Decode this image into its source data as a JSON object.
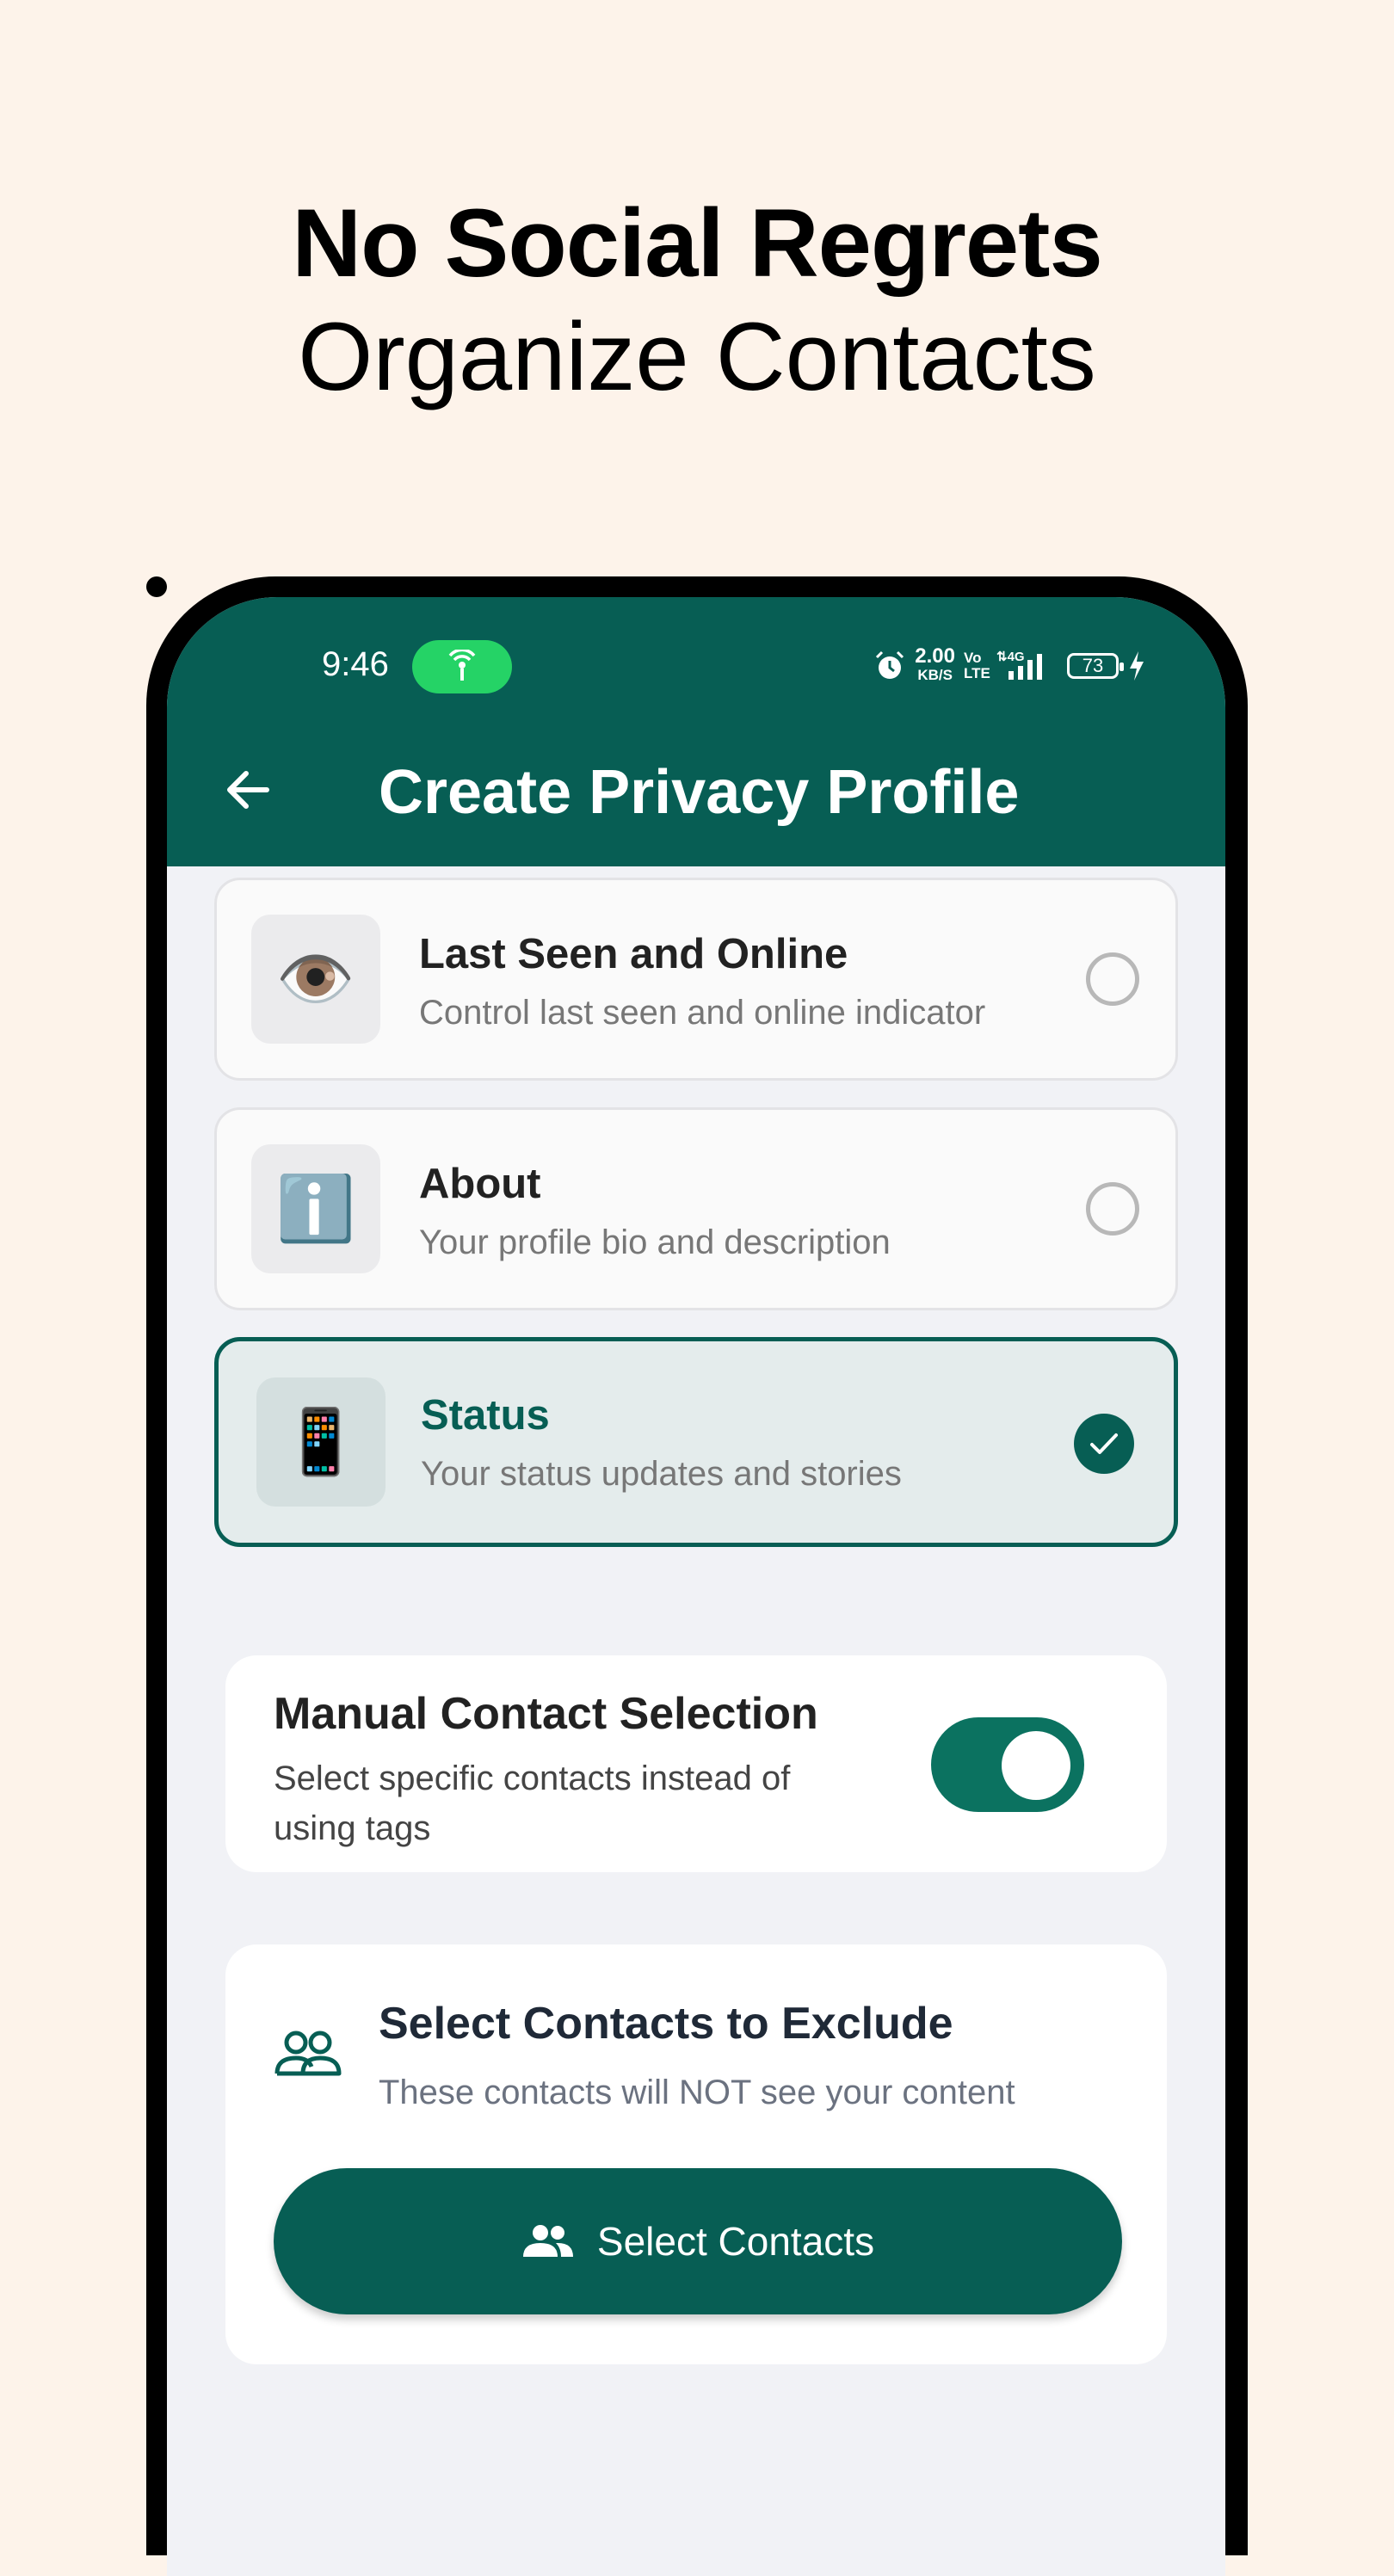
{
  "marketing": {
    "headline": "No Social Regrets",
    "subheadline": "Organize Contacts"
  },
  "status_bar": {
    "time": "9:46",
    "net_speed": "2.00",
    "net_speed_unit": "KB/S",
    "volte": "Vo LTE",
    "network": "4G",
    "battery": "73"
  },
  "app_bar": {
    "title": "Create Privacy Profile"
  },
  "options": [
    {
      "icon": "eye-icon",
      "emoji": "👁️",
      "title": "Last Seen and Online",
      "description": "Control last seen and online indicator",
      "selected": false
    },
    {
      "icon": "info-icon",
      "emoji": "ℹ️",
      "title": "About",
      "description": "Your profile bio and description",
      "selected": false
    },
    {
      "icon": "mobile-phone-icon",
      "emoji": "📱",
      "title": "Status",
      "description": "Your status updates and stories",
      "selected": true
    }
  ],
  "manual_selection": {
    "title": "Manual Contact Selection",
    "description": "Select specific contacts instead of using tags",
    "enabled": true
  },
  "exclude": {
    "icon": "people-icon",
    "title": "Select Contacts to Exclude",
    "description": "These contacts will NOT see your content",
    "button_label": "Select Contacts"
  },
  "colors": {
    "brand": "#075e54",
    "toggle_on": "#0b7260",
    "background": "#fdf3ea",
    "hotspot": "#25d366"
  }
}
